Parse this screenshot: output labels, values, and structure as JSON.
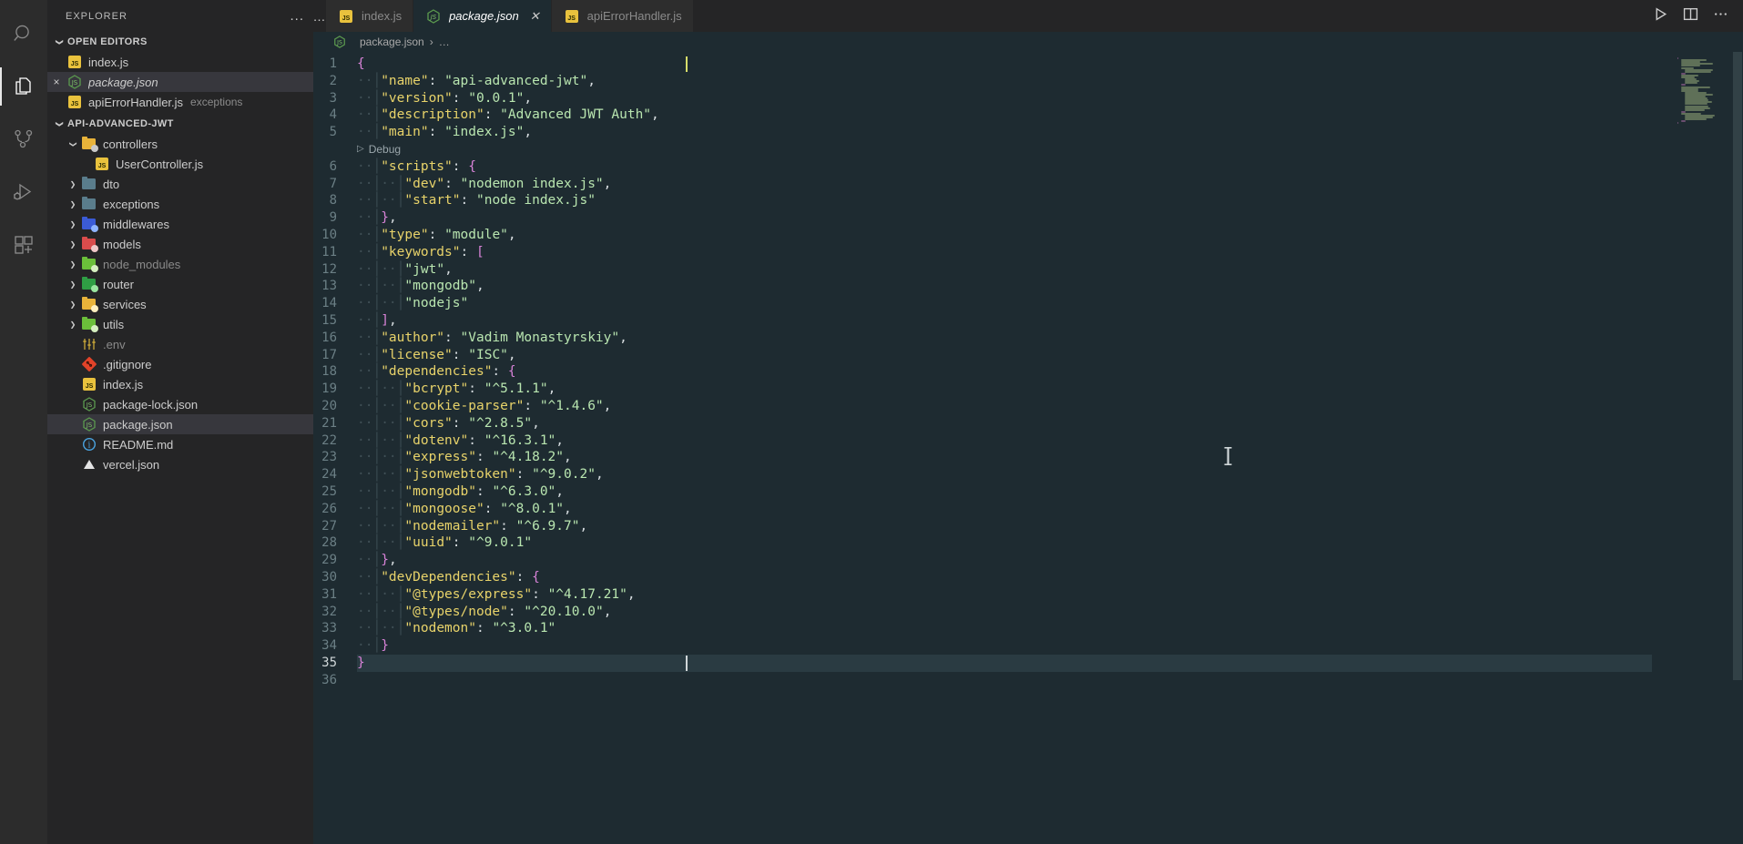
{
  "activitybar": {
    "items": [
      {
        "name": "search-icon",
        "label": "Search"
      },
      {
        "name": "explorer-icon",
        "label": "Explorer",
        "active": true
      },
      {
        "name": "source-control-icon",
        "label": "Source Control"
      },
      {
        "name": "run-debug-icon",
        "label": "Run and Debug"
      },
      {
        "name": "extensions-icon",
        "label": "Extensions"
      }
    ]
  },
  "sidebar": {
    "title": "EXPLORER",
    "more_actions": "...",
    "open_editors": {
      "label": "OPEN EDITORS",
      "expanded": true,
      "items": [
        {
          "label": "index.js",
          "icon": "js-file-icon",
          "dirty": false,
          "selected": false,
          "italic": false,
          "sub": ""
        },
        {
          "label": "package.json",
          "icon": "node-json-icon",
          "dirty": false,
          "selected": true,
          "italic": true,
          "sub": "",
          "close": "×"
        },
        {
          "label": "apiErrorHandler.js",
          "icon": "js-file-icon",
          "selected": false,
          "italic": false,
          "sub": "exceptions"
        }
      ]
    },
    "workspace": {
      "label": "API-ADVANCED-JWT",
      "expanded": true,
      "tree": [
        {
          "label": "controllers",
          "type": "folder",
          "expanded": true,
          "depth": 1,
          "color": "#e8b33a",
          "dot": "#c9c9c9"
        },
        {
          "label": "UserController.js",
          "type": "js",
          "depth": 2
        },
        {
          "label": "dto",
          "type": "folder",
          "expanded": false,
          "depth": 1,
          "color": "#5a7d8c",
          "dot": ""
        },
        {
          "label": "exceptions",
          "type": "folder",
          "expanded": false,
          "depth": 1,
          "color": "#5a7d8c",
          "dot": ""
        },
        {
          "label": "middlewares",
          "type": "folder",
          "expanded": false,
          "depth": 1,
          "color": "#3b5bd6",
          "dot": "#8fb4ff"
        },
        {
          "label": "models",
          "type": "folder",
          "expanded": false,
          "depth": 1,
          "color": "#d94c4c",
          "dot": "#f0c8c8"
        },
        {
          "label": "node_modules",
          "type": "folder",
          "expanded": false,
          "depth": 1,
          "color": "#6bbf3a",
          "dot": "#d6f0c0",
          "dim": true
        },
        {
          "label": "router",
          "type": "folder",
          "expanded": false,
          "depth": 1,
          "color": "#2f9e44",
          "dot": "#9ae6a0"
        },
        {
          "label": "services",
          "type": "folder",
          "expanded": false,
          "depth": 1,
          "color": "#e8b33a",
          "dot": "#fff0bf"
        },
        {
          "label": "utils",
          "type": "folder",
          "expanded": false,
          "depth": 1,
          "color": "#6bbf3a",
          "dot": "#d6f0c0"
        },
        {
          "label": ".env",
          "type": "env",
          "depth": 1,
          "dim": true
        },
        {
          "label": ".gitignore",
          "type": "git",
          "depth": 1
        },
        {
          "label": "index.js",
          "type": "js",
          "depth": 1
        },
        {
          "label": "package-lock.json",
          "type": "node",
          "depth": 1
        },
        {
          "label": "package.json",
          "type": "node",
          "depth": 1,
          "selected": true
        },
        {
          "label": "README.md",
          "type": "info",
          "depth": 1
        },
        {
          "label": "vercel.json",
          "type": "vercel",
          "depth": 1
        }
      ]
    }
  },
  "tabs": {
    "overflow": "…",
    "items": [
      {
        "label": "index.js",
        "icon": "js-file-icon",
        "active": false
      },
      {
        "label": "package.json",
        "icon": "node-json-icon",
        "active": true,
        "close": "✕"
      },
      {
        "label": "apiErrorHandler.js",
        "icon": "js-file-icon",
        "active": false
      }
    ],
    "actions": [
      {
        "name": "run-file-icon"
      },
      {
        "name": "split-editor-icon"
      },
      {
        "name": "more-actions-icon"
      }
    ]
  },
  "breadcrumb": {
    "file": "package.json",
    "separator": "›",
    "tail": "…"
  },
  "editor": {
    "codelens": {
      "line_after": 5,
      "label": "Debug",
      "icon": "play-icon"
    },
    "total_lines": 36,
    "cursor_line": 35,
    "lines": [
      {
        "n": 1,
        "indent": 0,
        "tokens": [
          [
            "punc",
            "{"
          ]
        ]
      },
      {
        "n": 2,
        "indent": 1,
        "tokens": [
          [
            "key",
            "\"name\""
          ],
          [
            "white",
            ": "
          ],
          [
            "str",
            "\"api-advanced-jwt\""
          ],
          [
            "white",
            ","
          ]
        ]
      },
      {
        "n": 3,
        "indent": 1,
        "tokens": [
          [
            "key",
            "\"version\""
          ],
          [
            "white",
            ": "
          ],
          [
            "str",
            "\"0.0.1\""
          ],
          [
            "white",
            ","
          ]
        ]
      },
      {
        "n": 4,
        "indent": 1,
        "tokens": [
          [
            "key",
            "\"description\""
          ],
          [
            "white",
            ": "
          ],
          [
            "str",
            "\"Advanced JWT Auth\""
          ],
          [
            "white",
            ","
          ]
        ]
      },
      {
        "n": 5,
        "indent": 1,
        "tokens": [
          [
            "key",
            "\"main\""
          ],
          [
            "white",
            ": "
          ],
          [
            "str",
            "\"index.js\""
          ],
          [
            "white",
            ","
          ]
        ]
      },
      {
        "n": 6,
        "indent": 1,
        "tokens": [
          [
            "key",
            "\"scripts\""
          ],
          [
            "white",
            ": "
          ],
          [
            "punc",
            "{"
          ]
        ]
      },
      {
        "n": 7,
        "indent": 2,
        "tokens": [
          [
            "key",
            "\"dev\""
          ],
          [
            "white",
            ": "
          ],
          [
            "str",
            "\"nodemon index.js\""
          ],
          [
            "white",
            ","
          ]
        ]
      },
      {
        "n": 8,
        "indent": 2,
        "tokens": [
          [
            "key",
            "\"start\""
          ],
          [
            "white",
            ": "
          ],
          [
            "str",
            "\"node index.js\""
          ]
        ]
      },
      {
        "n": 9,
        "indent": 1,
        "tokens": [
          [
            "punc",
            "}"
          ],
          [
            "white",
            ","
          ]
        ]
      },
      {
        "n": 10,
        "indent": 1,
        "tokens": [
          [
            "key",
            "\"type\""
          ],
          [
            "white",
            ": "
          ],
          [
            "str",
            "\"module\""
          ],
          [
            "white",
            ","
          ]
        ]
      },
      {
        "n": 11,
        "indent": 1,
        "tokens": [
          [
            "key",
            "\"keywords\""
          ],
          [
            "white",
            ": "
          ],
          [
            "punc",
            "["
          ]
        ]
      },
      {
        "n": 12,
        "indent": 2,
        "tokens": [
          [
            "str",
            "\"jwt\""
          ],
          [
            "white",
            ","
          ]
        ]
      },
      {
        "n": 13,
        "indent": 2,
        "tokens": [
          [
            "str",
            "\"mongodb\""
          ],
          [
            "white",
            ","
          ]
        ]
      },
      {
        "n": 14,
        "indent": 2,
        "tokens": [
          [
            "str",
            "\"nodejs\""
          ]
        ]
      },
      {
        "n": 15,
        "indent": 1,
        "tokens": [
          [
            "punc",
            "]"
          ],
          [
            "white",
            ","
          ]
        ]
      },
      {
        "n": 16,
        "indent": 1,
        "tokens": [
          [
            "key",
            "\"author\""
          ],
          [
            "white",
            ": "
          ],
          [
            "str",
            "\"Vadim Monastyrskiy\""
          ],
          [
            "white",
            ","
          ]
        ]
      },
      {
        "n": 17,
        "indent": 1,
        "tokens": [
          [
            "key",
            "\"license\""
          ],
          [
            "white",
            ": "
          ],
          [
            "str",
            "\"ISC\""
          ],
          [
            "white",
            ","
          ]
        ]
      },
      {
        "n": 18,
        "indent": 1,
        "tokens": [
          [
            "key",
            "\"dependencies\""
          ],
          [
            "white",
            ": "
          ],
          [
            "punc",
            "{"
          ]
        ]
      },
      {
        "n": 19,
        "indent": 2,
        "tokens": [
          [
            "key",
            "\"bcrypt\""
          ],
          [
            "white",
            ": "
          ],
          [
            "str",
            "\"^5.1.1\""
          ],
          [
            "white",
            ","
          ]
        ]
      },
      {
        "n": 20,
        "indent": 2,
        "tokens": [
          [
            "key",
            "\"cookie-parser\""
          ],
          [
            "white",
            ": "
          ],
          [
            "str",
            "\"^1.4.6\""
          ],
          [
            "white",
            ","
          ]
        ]
      },
      {
        "n": 21,
        "indent": 2,
        "tokens": [
          [
            "key",
            "\"cors\""
          ],
          [
            "white",
            ": "
          ],
          [
            "str",
            "\"^2.8.5\""
          ],
          [
            "white",
            ","
          ]
        ]
      },
      {
        "n": 22,
        "indent": 2,
        "tokens": [
          [
            "key",
            "\"dotenv\""
          ],
          [
            "white",
            ": "
          ],
          [
            "str",
            "\"^16.3.1\""
          ],
          [
            "white",
            ","
          ]
        ]
      },
      {
        "n": 23,
        "indent": 2,
        "tokens": [
          [
            "key",
            "\"express\""
          ],
          [
            "white",
            ": "
          ],
          [
            "str",
            "\"^4.18.2\""
          ],
          [
            "white",
            ","
          ]
        ]
      },
      {
        "n": 24,
        "indent": 2,
        "tokens": [
          [
            "key",
            "\"jsonwebtoken\""
          ],
          [
            "white",
            ": "
          ],
          [
            "str",
            "\"^9.0.2\""
          ],
          [
            "white",
            ","
          ]
        ]
      },
      {
        "n": 25,
        "indent": 2,
        "tokens": [
          [
            "key",
            "\"mongodb\""
          ],
          [
            "white",
            ": "
          ],
          [
            "str",
            "\"^6.3.0\""
          ],
          [
            "white",
            ","
          ]
        ]
      },
      {
        "n": 26,
        "indent": 2,
        "tokens": [
          [
            "key",
            "\"mongoose\""
          ],
          [
            "white",
            ": "
          ],
          [
            "str",
            "\"^8.0.1\""
          ],
          [
            "white",
            ","
          ]
        ]
      },
      {
        "n": 27,
        "indent": 2,
        "tokens": [
          [
            "key",
            "\"nodemailer\""
          ],
          [
            "white",
            ": "
          ],
          [
            "str",
            "\"^6.9.7\""
          ],
          [
            "white",
            ","
          ]
        ]
      },
      {
        "n": 28,
        "indent": 2,
        "tokens": [
          [
            "key",
            "\"uuid\""
          ],
          [
            "white",
            ": "
          ],
          [
            "str",
            "\"^9.0.1\""
          ]
        ]
      },
      {
        "n": 29,
        "indent": 1,
        "tokens": [
          [
            "punc",
            "}"
          ],
          [
            "white",
            ","
          ]
        ]
      },
      {
        "n": 30,
        "indent": 1,
        "tokens": [
          [
            "key",
            "\"devDependencies\""
          ],
          [
            "white",
            ": "
          ],
          [
            "punc",
            "{"
          ]
        ]
      },
      {
        "n": 31,
        "indent": 2,
        "tokens": [
          [
            "key",
            "\"@types/express\""
          ],
          [
            "white",
            ": "
          ],
          [
            "str",
            "\"^4.17.21\""
          ],
          [
            "white",
            ","
          ]
        ]
      },
      {
        "n": 32,
        "indent": 2,
        "tokens": [
          [
            "key",
            "\"@types/node\""
          ],
          [
            "white",
            ": "
          ],
          [
            "str",
            "\"^20.10.0\""
          ],
          [
            "white",
            ","
          ]
        ]
      },
      {
        "n": 33,
        "indent": 2,
        "tokens": [
          [
            "key",
            "\"nodemon\""
          ],
          [
            "white",
            ": "
          ],
          [
            "str",
            "\"^3.0.1\""
          ]
        ]
      },
      {
        "n": 34,
        "indent": 1,
        "tokens": [
          [
            "punc",
            "}"
          ]
        ]
      },
      {
        "n": 35,
        "indent": 0,
        "tokens": [
          [
            "punc",
            "}"
          ]
        ]
      },
      {
        "n": 36,
        "indent": 0,
        "tokens": []
      }
    ]
  },
  "colors": {
    "editor_bg": "#1e2b31",
    "sidebar_bg": "#252526",
    "activitybar_bg": "#2c2c2c",
    "key": "#e8d36a",
    "string": "#b9e6b0",
    "punctuation": "#d782d7",
    "line_number": "#6b7f85",
    "selection": "#2a3b42"
  }
}
